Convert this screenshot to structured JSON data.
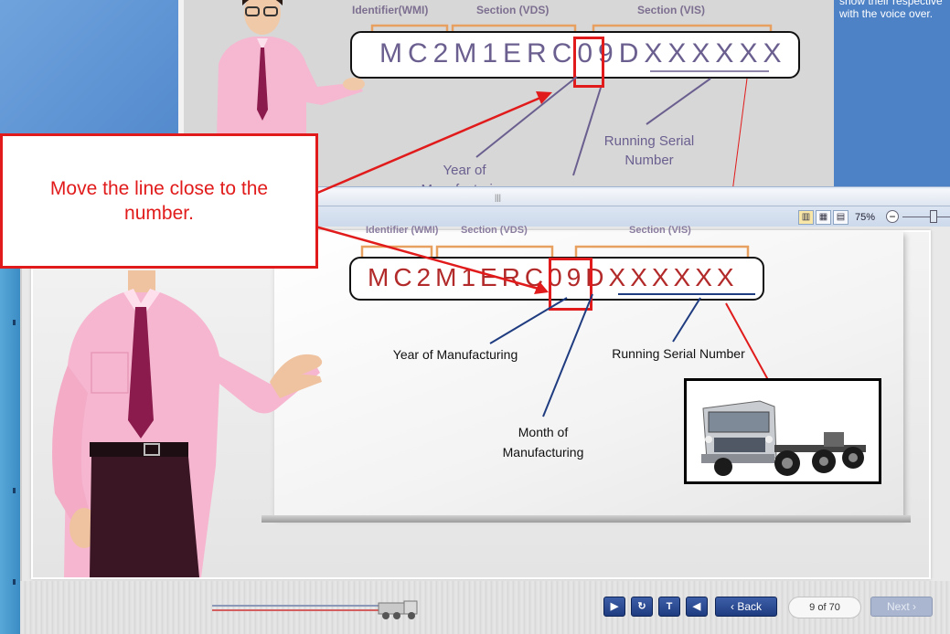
{
  "background_slide": {
    "headers": {
      "wmi": "Identifier(WMI)",
      "vds": "Section (VDS)",
      "vis": "Section (VIS)"
    },
    "vin_prefix": "MC2M1ERC",
    "vin_highlight": "09",
    "vin_suffix": "DXXXXXX",
    "label_year_line1": "Year of",
    "label_year_line2": "Manufacturing",
    "label_serial_line1": "Running Serial",
    "label_serial_line2": "Number",
    "notes_line1": "show their respective",
    "notes_line2": "with the voice over."
  },
  "window_chrome": {
    "zoom_level": "75%",
    "zoom_minus_label": "−"
  },
  "slide": {
    "headers": {
      "wmi": "Identifier (WMI)",
      "vds": "Section (VDS)",
      "vis": "Section (VIS)"
    },
    "vin_prefix": "MC2M1ERC",
    "vin_highlight": "09",
    "vin_suffix": "DXXXXXX",
    "label_year": "Year of Manufacturing",
    "label_month_line1": "Month of",
    "label_month_line2": "Manufacturing",
    "label_serial": "Running Serial Number"
  },
  "callout": {
    "line1": "Move the line close to the",
    "line2": "number."
  },
  "controls": {
    "play_icon": "play-icon",
    "replay_icon": "replay-icon",
    "text_icon": "T",
    "audio_icon": "speaker-icon",
    "back_label": "Back",
    "back_icon": "chevron-left-icon",
    "page_counter": "9 of 70",
    "next_label": "Next",
    "next_icon": "chevron-right-icon"
  },
  "colors": {
    "callout_red": "#e11b1b",
    "vin_red": "#b22a2a",
    "vin_purple": "#6b5f8f",
    "header_orange": "#e8a060",
    "control_blue": "#2b4a92"
  }
}
